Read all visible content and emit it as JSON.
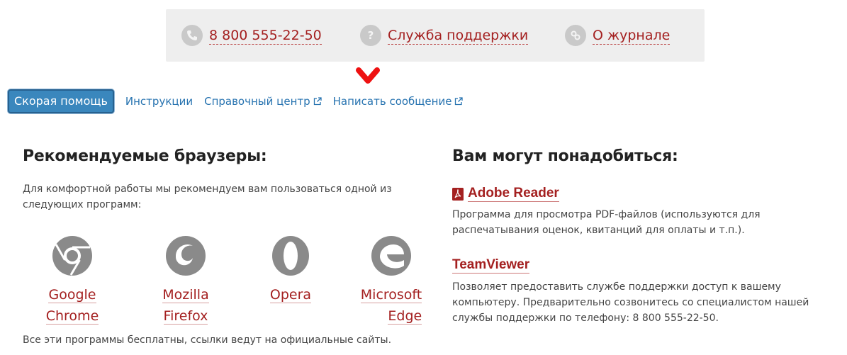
{
  "topbar": {
    "phone": "8 800 555-22-50",
    "support": "Служба поддержки",
    "about": "О журнале"
  },
  "tabs": [
    {
      "label": "Скорая помощь"
    },
    {
      "label": "Инструкции"
    },
    {
      "label": "Справочный центр"
    },
    {
      "label": "Написать сообщение"
    }
  ],
  "browsers_section": {
    "title": "Рекомендуемые браузеры:",
    "intro_line1": "Для комфортной работы мы рекомендуем вам пользоваться одной из",
    "intro_line2": "следующих программ:",
    "items": [
      {
        "line1": "Google",
        "line2": "Chrome",
        "icon": "chrome-icon"
      },
      {
        "line1": "Mozilla",
        "line2": "Firefox",
        "icon": "firefox-icon"
      },
      {
        "line1": "Opera",
        "line2": "",
        "icon": "opera-icon"
      },
      {
        "line1": "Microsoft",
        "line2": "Edge",
        "icon": "edge-icon"
      }
    ],
    "footer": "Все эти программы бесплатны, ссылки ведут на официальные сайты."
  },
  "resources_section": {
    "title": "Вам могут понадобиться:",
    "adobe": {
      "title": "Adobe Reader",
      "line1": "Программа для просмотра PDF-файлов (используются для",
      "line2": "распечатывания оценок, квитанций для оплаты и т.п.)."
    },
    "teamviewer": {
      "title": "TeamViewer",
      "line1": "Позволяет предоставить службе поддержки доступ к вашему",
      "line2": "компьютеру. Предварительно созвонитесь со специалистом нашей",
      "line3": "службы поддержки по телефону: 8 800 555-22-50."
    }
  },
  "colors": {
    "link_red": "#a42020",
    "link_blue": "#2773b0",
    "active_tab": "#3a87bd",
    "icon_gray": "#8a8a8a",
    "topbar_bg": "#eeeeee",
    "arrow": "#ee1111"
  }
}
